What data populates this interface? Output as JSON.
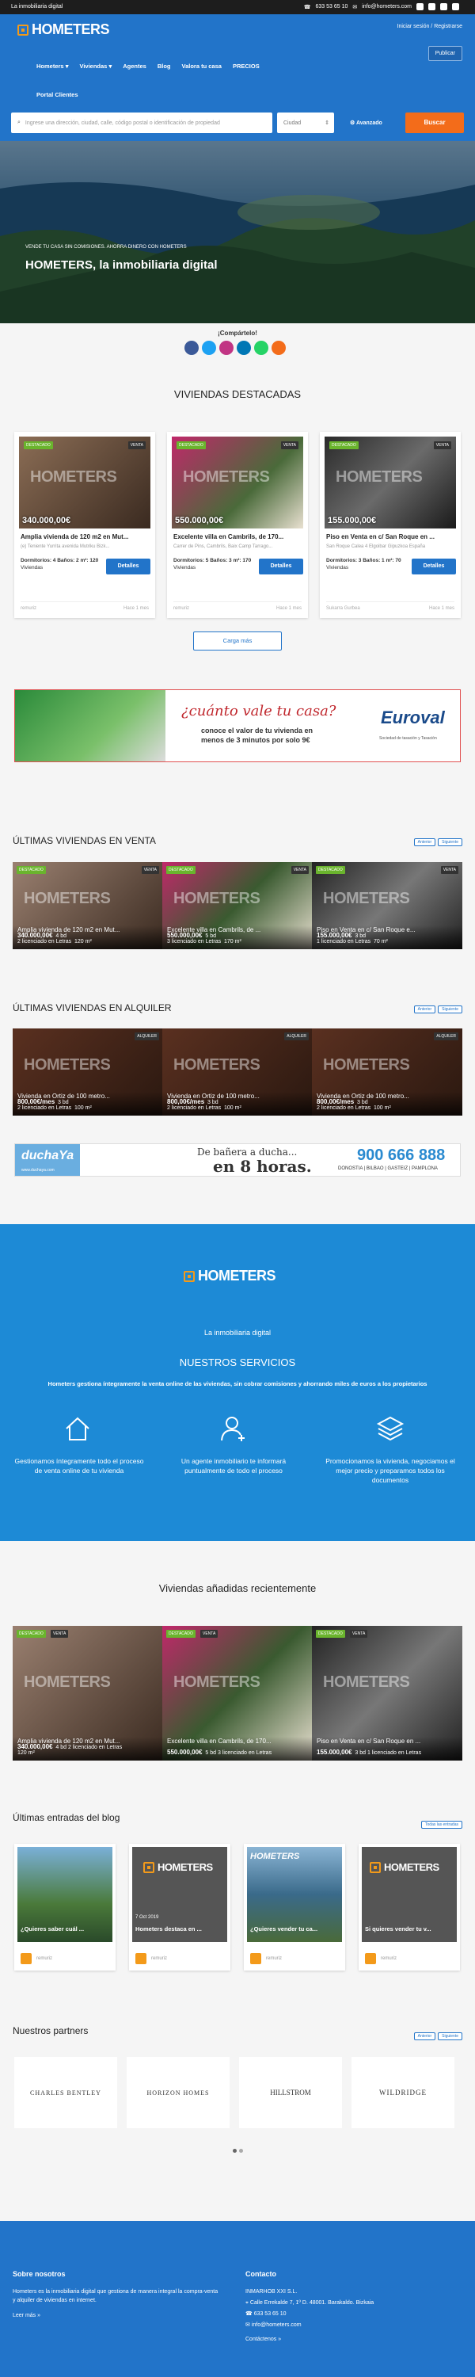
{
  "topbar": {
    "tagline": "La inmobiliaria digital",
    "phone": "633 53 65 10",
    "email": "info@hometers.com"
  },
  "header": {
    "logo": "HOMETERS",
    "login": "Iniciar sesión / Registrarse",
    "publish": "Publicar",
    "nav": [
      "Hometers",
      "Viviendas",
      "Agentes",
      "Blog",
      "Valora tu casa",
      "PRECIOS"
    ],
    "nav2": "Portal Clientes"
  },
  "search": {
    "placeholder": "Ingrese una dirección, ciudad, calle, código postal o identificación de propiedad",
    "city": "Ciudad",
    "advanced": "Avanzado",
    "button": "Buscar"
  },
  "hero": {
    "kicker": "VENDE TU CASA SIN COMISIONES. AHORRA DINERO CON HOMETERS",
    "title": "HOMETERS, la inmobiliaria digital",
    "share": "¡Compártelo!"
  },
  "featured": {
    "title": "VIVIENDAS DESTACADAS",
    "load_more": "Carga más",
    "details": "Detalles",
    "cards": [
      {
        "price": "340.000,00€",
        "title": "Amplia vivienda de 120 m2 en Mut...",
        "sub": "(e) Teniente Yurrita avenida Mutriku Bizk...",
        "features": "Dormitorios: 4  Baños: 2  m²: 120",
        "type": "Viviendas",
        "agent": "remuriz",
        "date": "Hace 1 mes",
        "status": "VENTA"
      },
      {
        "price": "550.000,00€",
        "title": "Excelente villa en Cambrils, de 170...",
        "sub": "Carrer de Pins, Cambrils, Baix Camp Tarrago...",
        "features": "Dormitorios: 5  Baños: 3  m²: 170",
        "type": "Viviendas",
        "agent": "remuriz",
        "date": "Hace 1 mes",
        "status": "VENTA"
      },
      {
        "price": "155.000,00€",
        "title": "Piso en Venta en c/ San Roque en ...",
        "sub": "San Roque Calea 4 Elgoibar Gipuzkoa España",
        "features": "Dormitorios: 3  Baños: 1  m²: 70",
        "type": "Viviendas",
        "agent": "Sukarra Gurbea",
        "date": "Hace 1 mes",
        "status": "VENTA"
      }
    ],
    "badge": "DESTACADO"
  },
  "ad1": {
    "line1": "¿cuánto vale tu casa?",
    "line2": "conoce el valor de tu vivienda en",
    "line3": "menos de 3 minutos por solo 9€",
    "brand": "Euroval",
    "brand_sub": "Sociedad de tasación y Tasación"
  },
  "sale": {
    "title": "ÚLTIMAS VIVIENDAS EN VENTA",
    "prev": "Anterior",
    "next": "Siguiente",
    "items": [
      {
        "title": "Amplia vivienda de 120 m2 en Mut...",
        "price": "340.000,00€",
        "meta": "4 bd",
        "meta2": "2 licenciado en Letras",
        "area": "120 m²"
      },
      {
        "title": "Excelente villa en Cambrils, de ...",
        "price": "550.000,00€",
        "meta": "5 bd",
        "meta2": "3 licenciado en Letras",
        "area": "170 m²"
      },
      {
        "title": "Piso en Venta en c/ San Roque e...",
        "price": "155.000,00€",
        "meta": "3 bd",
        "meta2": "1 licenciado en Letras",
        "area": "70 m²"
      }
    ]
  },
  "rent": {
    "title": "ÚLTIMAS VIVIENDAS EN ALQUILER",
    "prev": "Anterior",
    "next": "Siguiente",
    "items": [
      {
        "title": "Vivienda en Ortiz de 100 metro...",
        "price": "800,00€/mes",
        "meta": "3 bd",
        "meta2": "2 licenciado en Letras",
        "area": "100 m²"
      },
      {
        "title": "Vivienda en Ortiz de 100 metro...",
        "price": "800,00€/mes",
        "meta": "3 bd",
        "meta2": "2 licenciado en Letras",
        "area": "100 m²"
      },
      {
        "title": "Vivienda en Ortiz de 100 metro...",
        "price": "800,00€/mes",
        "meta": "3 bd",
        "meta2": "2 licenciado en Letras",
        "area": "100 m²"
      }
    ],
    "badge": "ALQUILER"
  },
  "ad2": {
    "brand": "duchaYa",
    "site": "www.duchaya.com",
    "slogan": "De bañera a ducha...",
    "big": "en 8 horas.",
    "phone": "900 666 888",
    "cities": "DONOSTIA | BILBAO | GASTEIZ | PAMPLONA"
  },
  "services": {
    "logo": "HOMETERS",
    "tagline": "La inmobiliaria digital",
    "title": "NUESTROS SERVICIOS",
    "intro": "Hometers gestiona íntegramente la venta online de las viviendas, sin cobrar comisiones y ahorrando miles de euros a los propietarios",
    "items": [
      "Gestionamos íntegramente todo el proceso de venta online de tu vivienda",
      "Un agente inmobiliario te informará puntualmente de todo el proceso",
      "Promocionamos la vivienda, negociamos el mejor precio y preparamos todos los documentos"
    ]
  },
  "recent": {
    "title": "Viviendas añadidas recientemente",
    "items": [
      {
        "title": "Amplia vivienda de 120 m2 en Mut...",
        "price": "340.000,00€",
        "meta": "4 bd",
        "meta2": "2 licenciado en Letras",
        "area": "120 m²"
      },
      {
        "title": "Excelente villa en Cambrils, de 170...",
        "price": "550.000,00€",
        "meta": "5 bd",
        "meta2": "3 licenciado en Letras",
        "area": "170 m²"
      },
      {
        "title": "Piso en Venta en c/ San Roque en ...",
        "price": "155.000,00€",
        "meta": "3 bd",
        "meta2": "1 licenciado en Letras",
        "area": "70 m²"
      }
    ]
  },
  "blog": {
    "title": "Últimas entradas del blog",
    "all": "Todas las entradas",
    "posts": [
      {
        "title": "¿Quieres saber cuál ...",
        "author": "remuriz"
      },
      {
        "title": "Hometers destaca en ...",
        "author": "remuriz",
        "date": "7 Oct 2019"
      },
      {
        "title": "¿Quieres vender tu ca...",
        "author": "remuriz"
      },
      {
        "title": "Si quieres vender tu v...",
        "author": "remuriz"
      }
    ]
  },
  "partners": {
    "title": "Nuestros partners",
    "prev": "Anterior",
    "next": "Siguiente",
    "items": [
      "CHARLES BENTLEY",
      "HORIZON HOMES",
      "HILLSTROM",
      "WILDRIDGE"
    ]
  },
  "footer": {
    "about_title": "Sobre nosotros",
    "about": "Hometers es la inmobiliaria digital que gestiona de manera integral la compra-venta y alquiler de viviendas en internet.",
    "more": "Leer más »",
    "contact_title": "Contacto",
    "company": "INMARHOB XXI S.L.",
    "address": "Calle Errekalde 7, 1º D. 48001. Barakaldo. Bizkaia",
    "phone": "633 53 65 10",
    "email": "info@hometers.com",
    "contact_link": "Contáctenos »"
  },
  "colors": {
    "primary": "#2274c9",
    "accent": "#f39a1a",
    "green": "#6ab42d",
    "service_bg": "#1d8ad6"
  }
}
